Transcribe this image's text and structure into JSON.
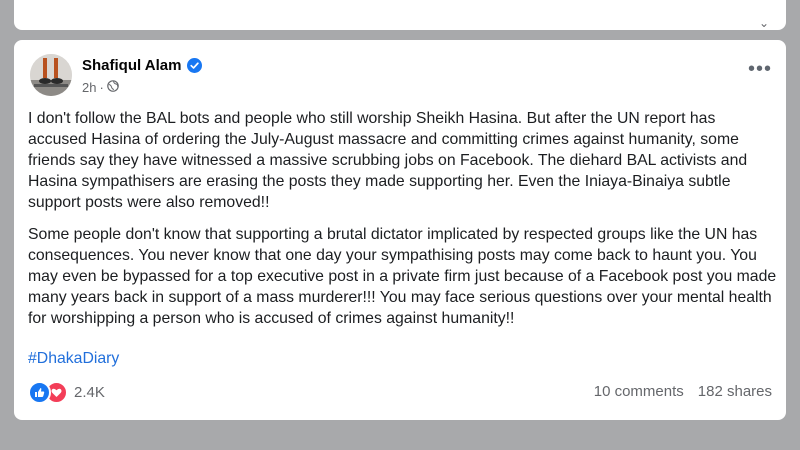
{
  "post": {
    "author": "Shafiqul Alam",
    "time": "2h",
    "paragraphs": [
      "I don't follow the BAL bots and people who still worship Sheikh Hasina. But after the UN report has accused Hasina of ordering the July-August massacre and committing crimes against humanity, some friends say they have witnessed a massive scrubbing jobs on Facebook. The diehard BAL activists and Hasina sympathisers are erasing   the posts they made supporting her. Even the Iniaya-Binaiya subtle support posts were also removed!!",
      "Some people don't know that supporting a brutal dictator implicated by respected groups like the UN has consequences. You never know that one day your sympathising posts may come back to haunt you. You may even be bypassed for a top executive post in a private firm just because of a Facebook post you made many years back in support of a mass murderer!!! You may face serious questions over your mental health for worshipping a person who is accused of crimes against humanity!!"
    ],
    "hashtag": "#DhakaDiary",
    "reactions_count": "2.4K",
    "comments": "10 comments",
    "shares": "182 shares",
    "more_glyph": "•••",
    "icons": {
      "verified": "verified-badge-icon",
      "privacy": "globe-icon",
      "reaction1": "like-reaction-icon",
      "reaction2": "love-reaction-icon",
      "more": "more-options-icon"
    },
    "colors": {
      "link": "#216fdb",
      "like": "#1877f2",
      "love": "#f33e58"
    }
  }
}
